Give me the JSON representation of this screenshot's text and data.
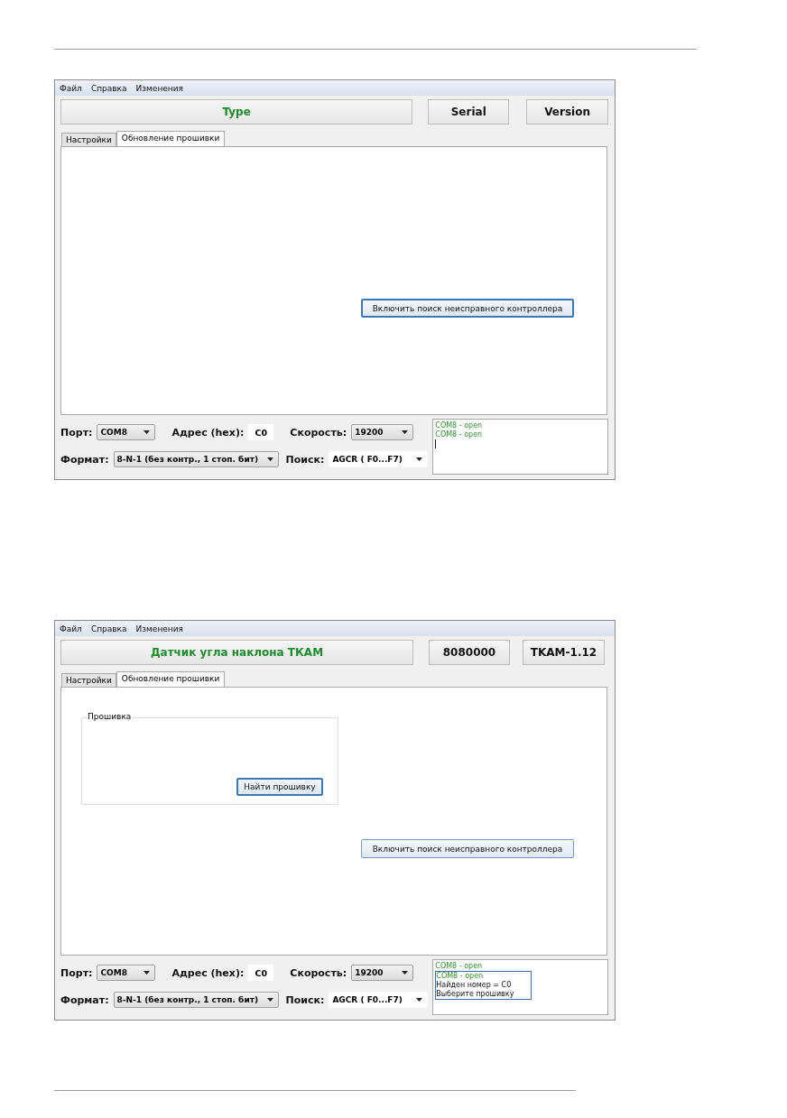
{
  "screens": [
    {
      "menu": [
        "Файл",
        "Справка",
        "Изменения"
      ],
      "header": {
        "type": "Type",
        "serial": "Serial",
        "version": "Version"
      },
      "tabs": [
        {
          "label": "Настройки",
          "selected": false
        },
        {
          "label": "Обновление прошивки",
          "selected": true
        }
      ],
      "search_button": {
        "label": "Включить поиск неисправного контроллера",
        "focused": true
      },
      "settings": [
        [
          {
            "label": "Порт:",
            "kind": "dropdown",
            "value": "COM8"
          },
          {
            "label": "Адрес (hex):",
            "kind": "text",
            "value": "C0"
          },
          {
            "label": "Скорость:",
            "kind": "dropdown",
            "value": "19200"
          }
        ],
        [
          {
            "label": "Формат:",
            "kind": "dropdown",
            "value": "8-N-1 (без контр., 1 стоп. бит)"
          },
          {
            "label": "Поиск:",
            "kind": "editable",
            "value": "AGCR ( F0...F7)"
          }
        ]
      ],
      "log": {
        "cursor": true,
        "lines": [
          {
            "text": "COM8 - open",
            "kind": "status",
            "highlighted": false
          },
          {
            "text": "COM8 - open",
            "kind": "status",
            "highlighted": false
          }
        ]
      }
    },
    {
      "menu": [
        "Файл",
        "Справка",
        "Изменения"
      ],
      "header": {
        "type": "Датчик угла наклона ТКАМ",
        "serial": "8080000",
        "version": "TKAM-1.12"
      },
      "tabs": [
        {
          "label": "Настройки",
          "selected": false
        },
        {
          "label": "Обновление прошивки",
          "selected": true
        }
      ],
      "firmware_group": {
        "title": "Прошивка",
        "button": {
          "label": "Найти прошивку",
          "focused": true
        }
      },
      "search_button": {
        "label": "Включить поиск неисправного контроллера",
        "focused": false
      },
      "settings": [
        [
          {
            "label": "Порт:",
            "kind": "dropdown",
            "value": "COM8"
          },
          {
            "label": "Адрес (hex):",
            "kind": "text",
            "value": "C0"
          },
          {
            "label": "Скорость:",
            "kind": "dropdown",
            "value": "19200"
          }
        ],
        [
          {
            "label": "Формат:",
            "kind": "dropdown",
            "value": "8-N-1 (без контр., 1 стоп. бит)"
          },
          {
            "label": "Поиск:",
            "kind": "editable",
            "value": "AGCR ( F0...F7)"
          }
        ]
      ],
      "log": {
        "cursor": false,
        "lines": [
          {
            "text": "COM8 - open",
            "kind": "status",
            "highlighted": false
          },
          {
            "text": "COM8 - open",
            "kind": "status",
            "highlighted": true
          },
          {
            "text": "Найден номер = C0",
            "kind": "message",
            "highlighted": true
          },
          {
            "text": "Выберите прошивку",
            "kind": "message",
            "highlighted": true
          }
        ]
      }
    }
  ]
}
